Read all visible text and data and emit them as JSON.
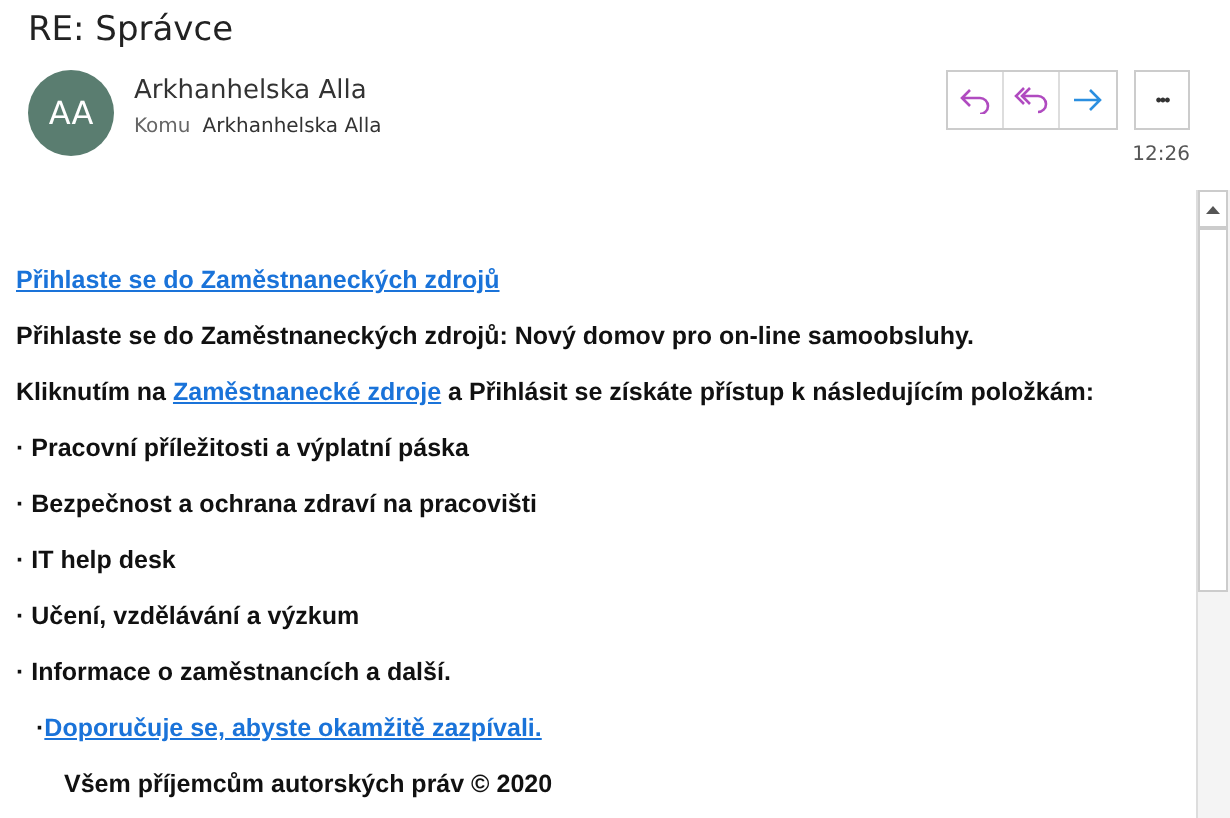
{
  "subject": "RE: Správce",
  "sender": {
    "initials": "AA",
    "name": "Arkhanhelska Alla",
    "to_label": "Komu",
    "to": "Arkhanhelska Alla",
    "time": "12:26"
  },
  "actions": [
    {
      "kind": "reply"
    },
    {
      "kind": "reply-all"
    },
    {
      "kind": "forward"
    }
  ],
  "more_label": "•••",
  "body": [
    {
      "kind": "paragraph",
      "parts": [
        {
          "kind": "link",
          "text": "Přihlaste se do Zaměstnaneckých zdrojů"
        }
      ]
    },
    {
      "kind": "paragraph",
      "parts": [
        {
          "kind": "text",
          "text": "Přihlaste se do Zaměstnaneckých zdrojů: Nový domov pro on-line samoobsluhy."
        }
      ]
    },
    {
      "kind": "paragraph",
      "parts": [
        {
          "kind": "text",
          "text": "Kliknutím na "
        },
        {
          "kind": "link",
          "text": "Zaměstnanecké zdroje"
        },
        {
          "kind": "text",
          "text": " a Přihlásit se získáte přístup k následujícím položkám:"
        }
      ]
    },
    {
      "kind": "paragraph",
      "parts": [
        {
          "kind": "text",
          "text": "· Pracovní příležitosti a výplatní páska"
        }
      ]
    },
    {
      "kind": "paragraph",
      "parts": [
        {
          "kind": "text",
          "text": "· Bezpečnost a ochrana zdraví na pracovišti"
        }
      ]
    },
    {
      "kind": "paragraph",
      "parts": [
        {
          "kind": "text",
          "text": "· IT help desk"
        }
      ]
    },
    {
      "kind": "paragraph",
      "parts": [
        {
          "kind": "text",
          "text": "· Učení, vzdělávání a výzkum"
        }
      ]
    },
    {
      "kind": "paragraph",
      "parts": [
        {
          "kind": "text",
          "text": "· Informace o zaměstnancích a další."
        }
      ]
    },
    {
      "kind": "note",
      "parts": [
        {
          "kind": "text",
          "text": "·"
        },
        {
          "kind": "link",
          "text": "Doporučuje se, abyste okamžitě zazpívali."
        }
      ]
    },
    {
      "kind": "signature",
      "parts": [
        {
          "kind": "text",
          "text": "Všem příjemcům autorských práv © 2020"
        }
      ]
    }
  ]
}
